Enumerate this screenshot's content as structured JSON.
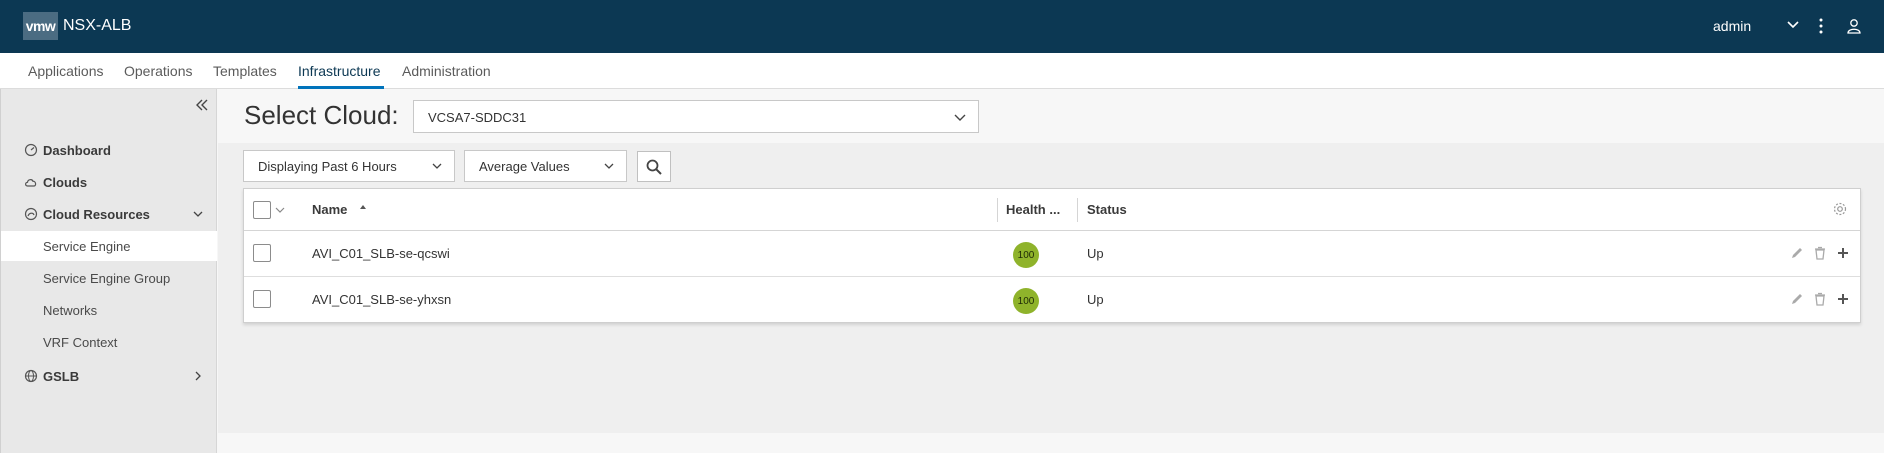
{
  "header": {
    "logo_text": "vmw",
    "product": "NSX-ALB",
    "user": "admin",
    "bg_color": "#0c3853"
  },
  "tabs": [
    {
      "label": "Applications",
      "active": false
    },
    {
      "label": "Operations",
      "active": false
    },
    {
      "label": "Templates",
      "active": false
    },
    {
      "label": "Infrastructure",
      "active": true
    },
    {
      "label": "Administration",
      "active": false
    }
  ],
  "sidebar": {
    "items": [
      {
        "label": "Dashboard",
        "icon": "dashboard-icon"
      },
      {
        "label": "Clouds",
        "icon": "cloud-icon"
      },
      {
        "label": "Cloud Resources",
        "icon": "cloud-resources-icon",
        "expanded": true
      },
      {
        "label": "Service Engine",
        "selected": true
      },
      {
        "label": "Service Engine Group"
      },
      {
        "label": "Networks"
      },
      {
        "label": "VRF Context"
      },
      {
        "label": "GSLB",
        "icon": "gslb-icon",
        "expanded": false
      }
    ]
  },
  "main": {
    "select_cloud_label": "Select Cloud:",
    "cloud_value": "VCSA7-SDDC31",
    "time_filter": "Displaying Past 6 Hours",
    "value_filter": "Average Values"
  },
  "table": {
    "columns": {
      "name": "Name",
      "health": "Health ...",
      "status": "Status"
    },
    "rows": [
      {
        "name": "AVI_C01_SLB-se-qcswi",
        "health": "100",
        "status": "Up"
      },
      {
        "name": "AVI_C01_SLB-se-yhxsn",
        "health": "100",
        "status": "Up"
      }
    ],
    "health_color": "#8fb32b"
  }
}
